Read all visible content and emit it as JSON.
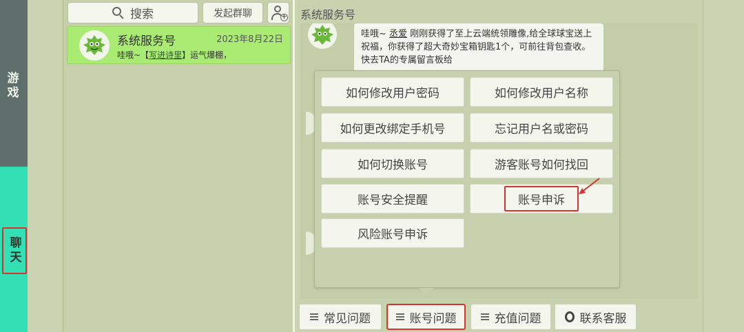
{
  "sidebar": {
    "tabs": [
      {
        "label": "游戏"
      },
      {
        "label": "聊天"
      }
    ]
  },
  "contacts_panel": {
    "search_label": "搜索",
    "group_chat_label": "发起群聊",
    "items": [
      {
        "name": "系统服务号",
        "date": "2023年8月22日",
        "preview_prefix": "哇哦~【",
        "preview_link": "写进诗里",
        "preview_suffix": "】运气爆棚，"
      }
    ]
  },
  "chat": {
    "title": "系统服务号",
    "message_name": "丞爱",
    "message_prefix": "哇哦~ ",
    "message_text": " 刚刚获得了至上云端统领雕像,给全球球宝送上祝福，你获得了超大奇妙宝箱钥匙1个，可前往背包查收。快去TA的专属留言板给"
  },
  "popup_menu": {
    "options": [
      {
        "label": "如何修改用户密码"
      },
      {
        "label": "如何修改用户名称"
      },
      {
        "label": "如何更改绑定手机号"
      },
      {
        "label": "忘记用户名或密码"
      },
      {
        "label": "如何切换账号"
      },
      {
        "label": "游客账号如何找回"
      },
      {
        "label": "账号安全提醒"
      },
      {
        "label": "账号申诉"
      },
      {
        "label": "风险账号申诉"
      }
    ]
  },
  "bottom_tabs": [
    {
      "label": "常见问题"
    },
    {
      "label": "账号问题"
    },
    {
      "label": "充值问题"
    },
    {
      "label": "联系客服"
    }
  ],
  "colors": {
    "annotation_red": "#d6332e",
    "active_tab": "#33e0b3",
    "selected_contact": "#a9eb73"
  }
}
